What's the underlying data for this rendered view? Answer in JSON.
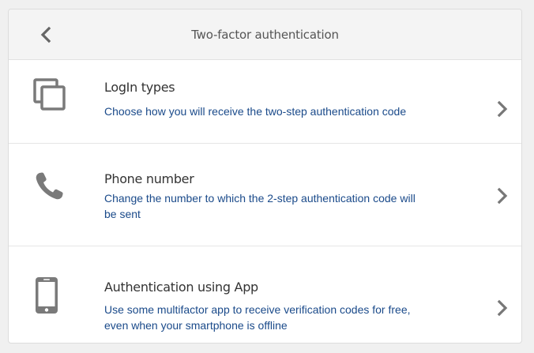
{
  "header": {
    "title": "Two-factor authentication",
    "back_icon": "chevron-left-icon"
  },
  "rows": [
    {
      "title": "LogIn types",
      "description": "Choose how you will receive the two-step authentication code",
      "icon": "copy-squares-icon"
    },
    {
      "title": "Phone number",
      "description": "Change the number to which the 2-step authentication code will be sent",
      "icon": "phone-icon"
    },
    {
      "title": "Authentication using App",
      "description": "Use some multifactor app to receive verification codes for free, even when your smartphone is offline",
      "icon": "smartphone-icon"
    }
  ],
  "colors": {
    "icon_gray": "#7a7a7a",
    "description_blue": "#1a4a8a",
    "title_text": "#333333",
    "header_bg": "#f4f4f4"
  }
}
